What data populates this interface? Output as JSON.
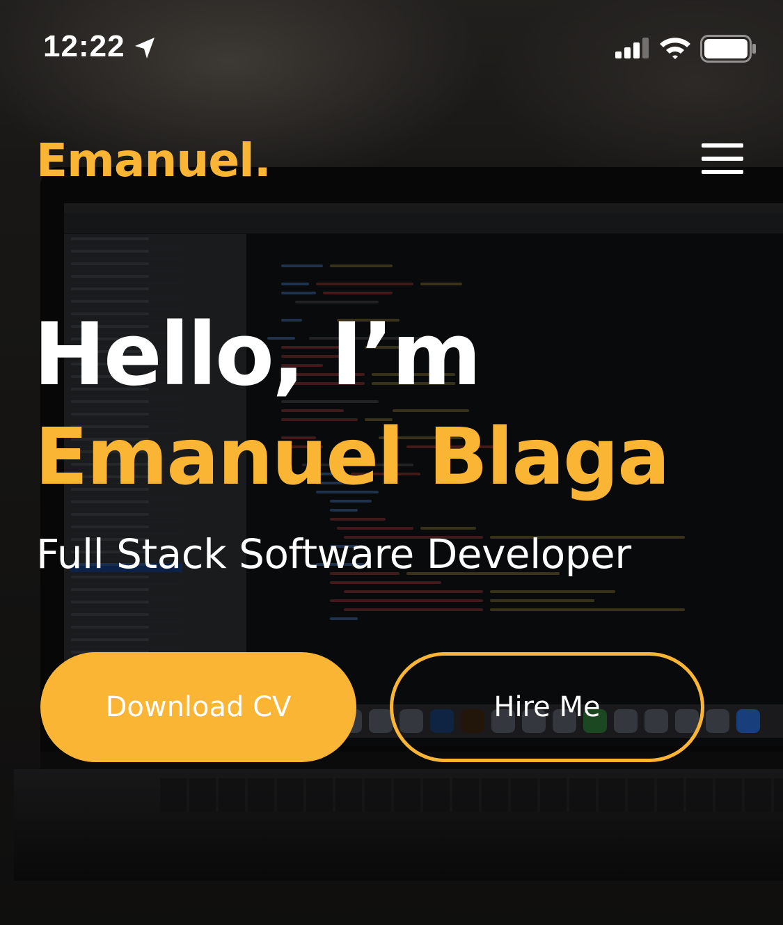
{
  "status_bar": {
    "time": "12:22",
    "icons": [
      "location-arrow-icon",
      "cellular-signal-icon",
      "wifi-icon",
      "battery-icon"
    ]
  },
  "nav": {
    "brand": "Emanuel.",
    "menu_icon": "hamburger-menu-icon"
  },
  "hero": {
    "greeting": "Hello, I’m",
    "name": "Emanuel Blaga",
    "role": "Full Stack Software Developer"
  },
  "actions": {
    "download_cv": "Download CV",
    "hire_me": "Hire Me"
  },
  "colors": {
    "accent": "#fbb535",
    "text": "#ffffff",
    "background": "#1a1918"
  }
}
